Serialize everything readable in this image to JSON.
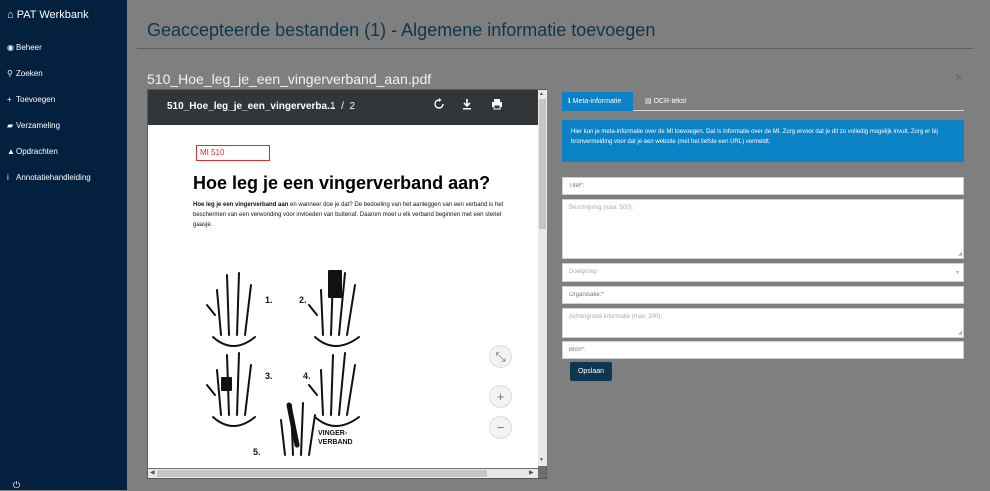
{
  "sidebar": {
    "brand": "PAT Werkbank",
    "items": [
      {
        "label": "Beheer",
        "icon": "dashboard-icon"
      },
      {
        "label": "Zoeken",
        "icon": "search-icon"
      },
      {
        "label": "Toevoegen",
        "icon": "plus-icon"
      },
      {
        "label": "Verzameling",
        "icon": "book-icon"
      },
      {
        "label": "Opdrachten",
        "icon": "graduation-cap-icon"
      },
      {
        "label": "Annotatiehandleiding",
        "icon": "info-icon"
      }
    ],
    "power_icon": "power-icon"
  },
  "header": {
    "title": "Geaccepteerde bestanden (1) - Algemene informatie toevoegen"
  },
  "modal": {
    "file_title": "510_Hoe_leg_je_een_vingerverband_aan.pdf",
    "close": "×"
  },
  "pdf": {
    "toolbar_name": "510_Hoe_leg_je_een_vingerverba...",
    "page_current": "1",
    "page_sep": "/",
    "page_total": "2",
    "doc": {
      "mi_label": "MI 510",
      "heading": "Hoe leg je een vingerverband aan?",
      "body_bold": "Hoe leg je een vingerverband aan",
      "body_rest": " en wanneer doe je dat? De bedoeling van het aanleggen van een verband is het beschermen van een verwonding voor invloeden van buitenaf. Daarom moet u elk verband beginnen met een steriel gaasje.",
      "figure_labels": [
        "1.",
        "2.",
        "3.",
        "4.",
        "5.",
        "VINGER-",
        "VERBAND"
      ]
    },
    "controls": {
      "fit": "⤡",
      "zoom_in": "+",
      "zoom_out": "−"
    }
  },
  "tabs": [
    {
      "label": "Meta-informatie",
      "icon": "info-icon",
      "active": true
    },
    {
      "label": "OCR-tekst",
      "icon": "file-icon",
      "active": false
    }
  ],
  "info_text": "Hier kun je meta-informatie over de MI toevoegen. Dat is informatie over de MI. Zorg ervoor dat je dit zo volledig mogelijk invult. Zorg er bij bronvermelding voor dat je een website (met het liefste een URL) vermeldt.",
  "form": {
    "title_placeholder": "Titel*:",
    "description_placeholder": "Beschrijving (max. 500):",
    "audience_placeholder": "Doelgroep",
    "organisation_placeholder": "Organisatie:*",
    "background_placeholder": "Achtergrond-informatie (max. 200):",
    "source_placeholder": "Bron*:",
    "save_label": "Opslaan"
  },
  "colors": {
    "sidebar": "#03213f",
    "accent": "#0a82c5",
    "title": "#0e3650",
    "overlay": "#7f7f7f"
  }
}
